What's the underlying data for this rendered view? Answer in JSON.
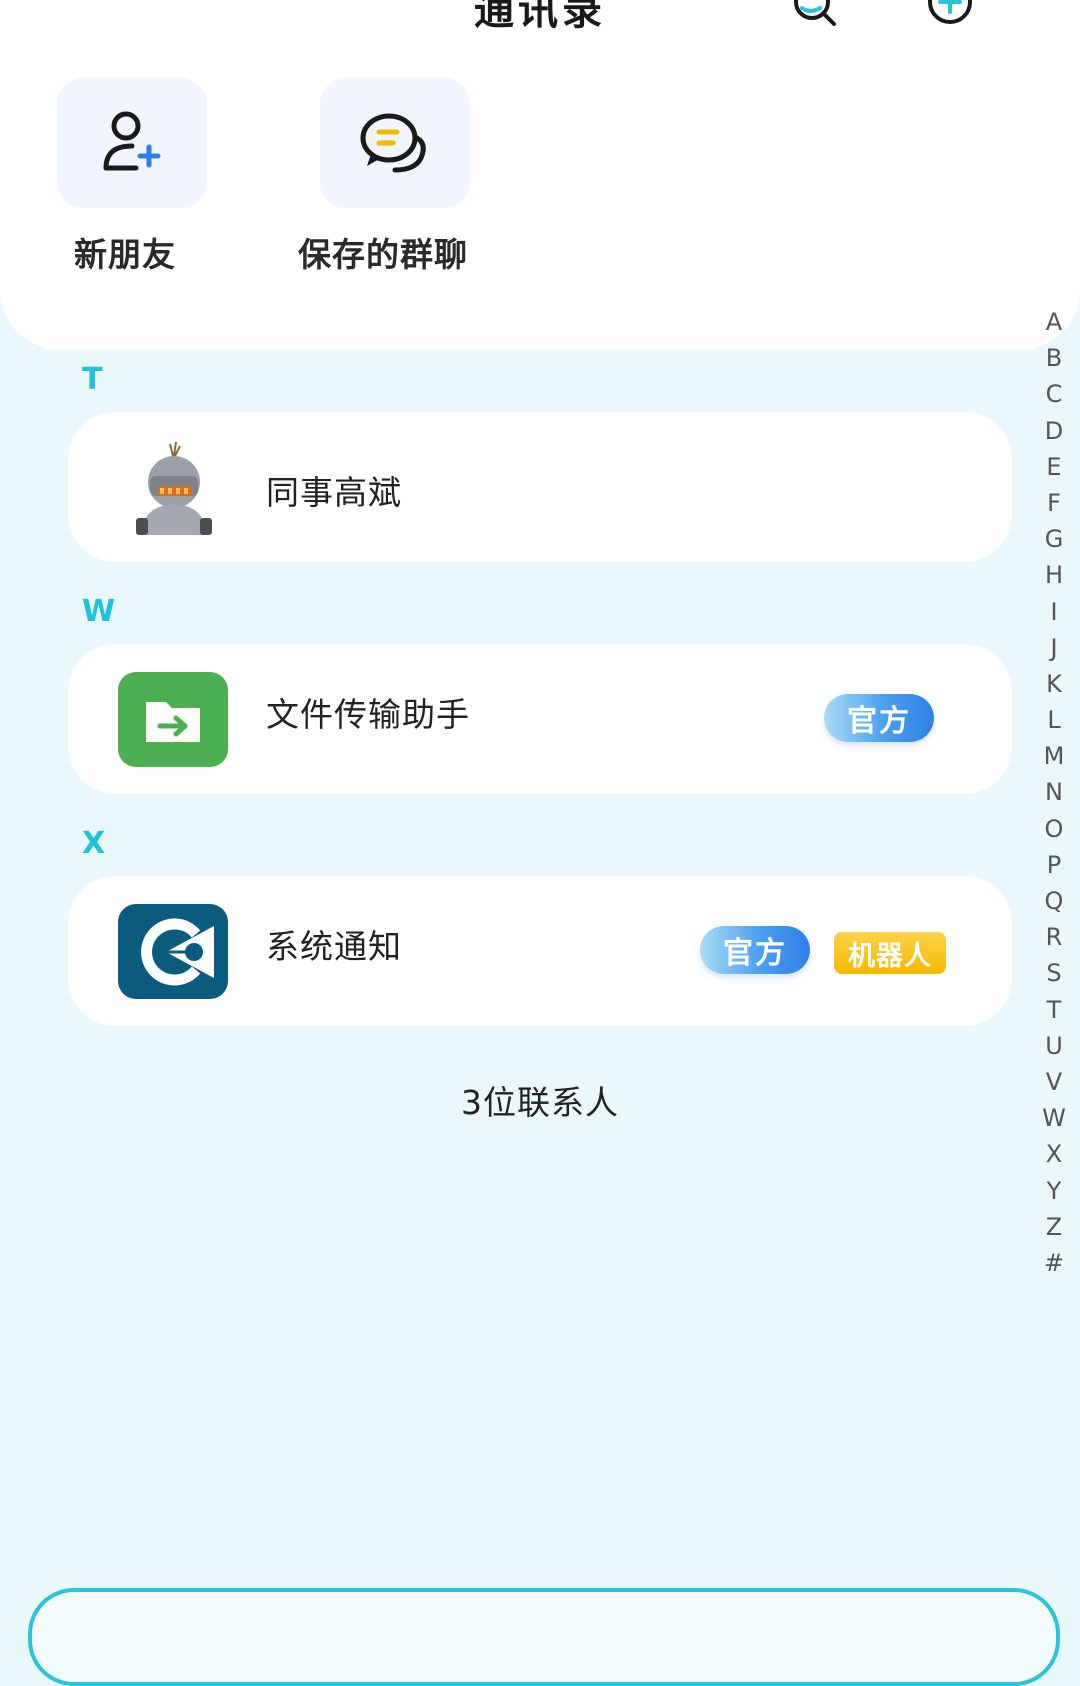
{
  "header": {
    "title": "通讯录"
  },
  "quick_actions": [
    {
      "label": "新朋友",
      "icon": "add-user-icon"
    },
    {
      "label": "保存的群聊",
      "icon": "group-chat-icon"
    }
  ],
  "sections": [
    {
      "letter": "T",
      "contacts": [
        {
          "name": "同事高斌",
          "badges": []
        }
      ]
    },
    {
      "letter": "W",
      "contacts": [
        {
          "name": "文件传输助手",
          "badges": [
            "官方"
          ]
        }
      ]
    },
    {
      "letter": "X",
      "contacts": [
        {
          "name": "系统通知",
          "badges": [
            "官方",
            "机器人"
          ]
        }
      ]
    }
  ],
  "contact_count": "3位联系人",
  "index": [
    "A",
    "B",
    "C",
    "D",
    "E",
    "F",
    "G",
    "H",
    "I",
    "J",
    "K",
    "L",
    "M",
    "N",
    "O",
    "P",
    "Q",
    "R",
    "S",
    "T",
    "U",
    "V",
    "W",
    "X",
    "Y",
    "Z",
    "#"
  ],
  "colors": {
    "accent": "#1fc2dd",
    "background": "#eaf7fb",
    "official_badge": "#4b9ff0",
    "robot_badge": "#f6b800",
    "file_helper_avatar": "#4caf50",
    "system_avatar": "#0a5b7d"
  }
}
